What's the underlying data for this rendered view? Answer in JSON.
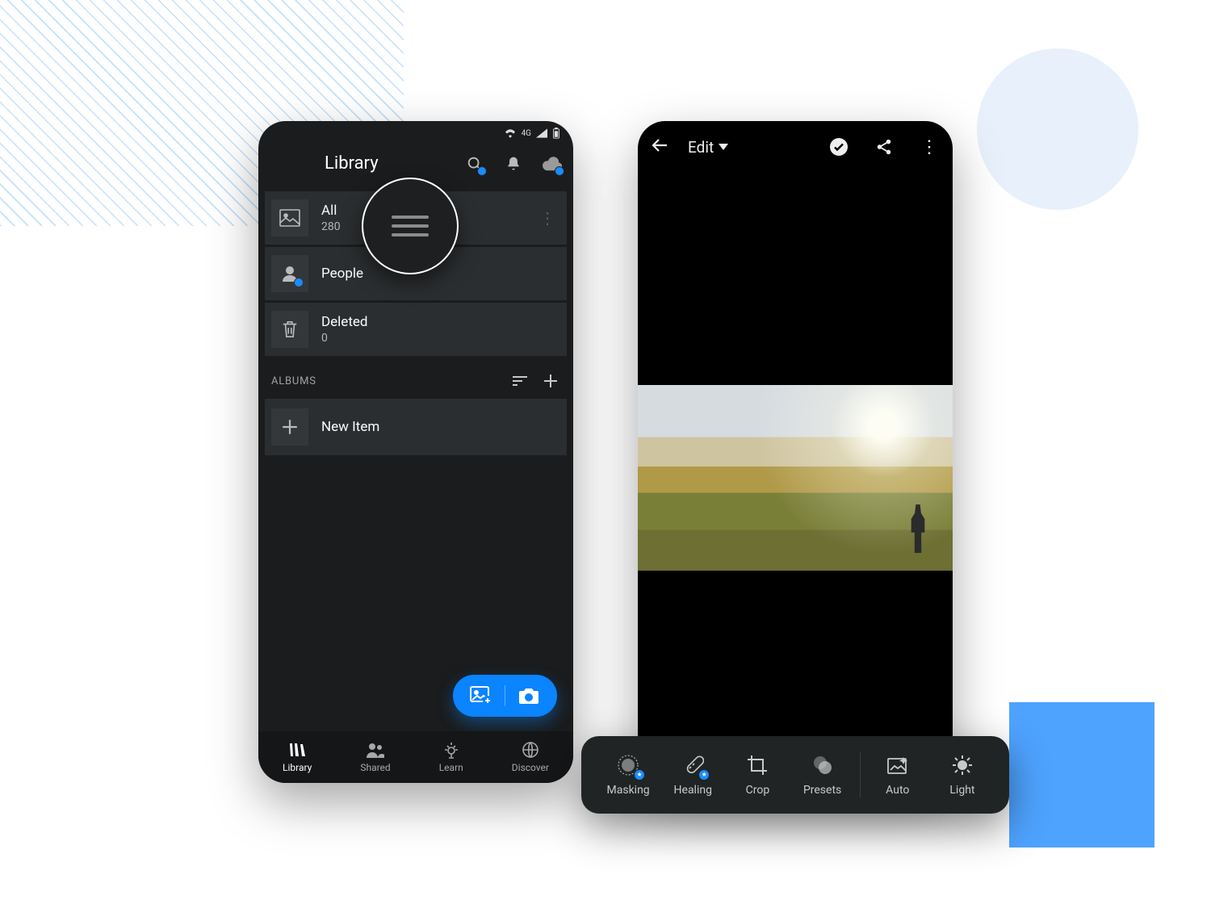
{
  "statusbar": {
    "network_label": "4G"
  },
  "left": {
    "title": "Library",
    "items": {
      "all": {
        "label": "All",
        "count": "280"
      },
      "people": {
        "label": "People"
      },
      "deleted": {
        "label": "Deleted",
        "count": "0"
      }
    },
    "albums_header": "ALBUMS",
    "new_item_label": "New Item",
    "nav": {
      "library": "Library",
      "shared": "Shared",
      "learn": "Learn",
      "discover": "Discover"
    }
  },
  "right": {
    "title": "Edit",
    "tools": {
      "masking": "Masking",
      "healing": "Healing",
      "crop": "Crop",
      "presets": "Presets",
      "auto": "Auto",
      "light": "Light"
    }
  }
}
